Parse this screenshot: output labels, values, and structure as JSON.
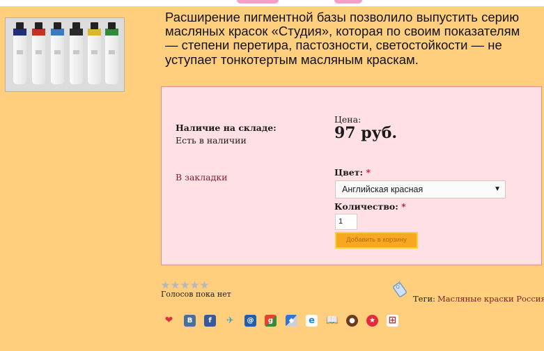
{
  "product": {
    "description": "Расширение пигментной базы позволило выпустить серию масляных красок «Студия», которая по своим показателям — степени перетира, пастозности, светостойкости — не уступает тонкотертым масляным краскам.",
    "image_icon": "paint-tubes-image",
    "tube_colors": [
      "#1e2f78",
      "#c23326",
      "#3a7ac0",
      "#2a2a2a",
      "#d8b82a",
      "#2f8a3a"
    ]
  },
  "order": {
    "stock_label": "Наличие на складе:",
    "stock_value": "Есть в наличии",
    "bookmark_label": "В закладки",
    "price_label": "Цена:",
    "price_value": "97 руб.",
    "color_label": "Цвет:",
    "required_mark": "*",
    "color_selected": "Английская красная",
    "qty_label": "Количество:",
    "qty_value": "1",
    "cart_button": "Добавить в корзину"
  },
  "rating": {
    "votes_text": "Голосов пока нет",
    "stars_total": 5,
    "stars_filled": 0
  },
  "tags": {
    "label": "Теги:",
    "link": "Масляные краски Россия",
    "icon": "tag-icon"
  },
  "share": {
    "icons": [
      "heart-bookmark-icon",
      "vk-icon",
      "facebook-icon",
      "twitter-icon",
      "myworld-icon",
      "google-icon",
      "delicious-icon",
      "ie-favorites-icon",
      "bookmarks-book-icon",
      "moikrug-icon",
      "star-bookmark-icon",
      "grid-icon"
    ]
  },
  "colors": {
    "page_bg": "#ffcf7d",
    "box_bg": "#ffe0e4",
    "box_border": "#e48b8b",
    "link": "#7a1e2a",
    "required": "#d0102a",
    "button": "#f7a823"
  }
}
